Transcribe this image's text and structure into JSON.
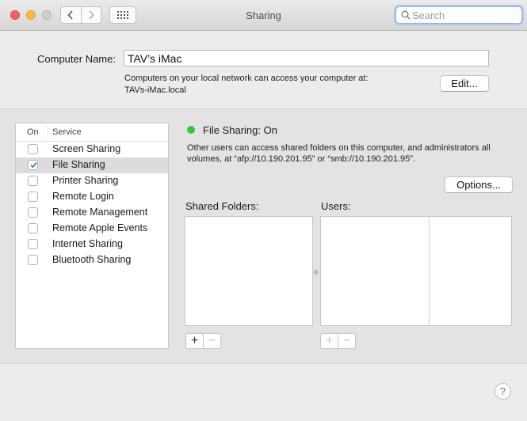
{
  "window": {
    "title": "Sharing"
  },
  "search": {
    "placeholder": "Search"
  },
  "computer_name": {
    "label": "Computer Name:",
    "value": "TAV’s iMac",
    "description_line1": "Computers on your local network can access your computer at:",
    "description_line2": "TAVs-iMac.local",
    "edit_label": "Edit..."
  },
  "services": {
    "header_on": "On",
    "header_service": "Service",
    "items": [
      {
        "label": "Screen Sharing",
        "checked": false
      },
      {
        "label": "File Sharing",
        "checked": true
      },
      {
        "label": "Printer Sharing",
        "checked": false
      },
      {
        "label": "Remote Login",
        "checked": false
      },
      {
        "label": "Remote Management",
        "checked": false
      },
      {
        "label": "Remote Apple Events",
        "checked": false
      },
      {
        "label": "Internet Sharing",
        "checked": false
      },
      {
        "label": "Bluetooth Sharing",
        "checked": false
      }
    ]
  },
  "status": {
    "text": "File Sharing: On",
    "color": "#35c63d",
    "description": "Other users can access shared folders on this computer, and administrators all volumes, at “afp://10.190.201.95” or “smb://10.190.201.95”."
  },
  "options_label": "Options...",
  "shared_folders_label": "Shared Folders:",
  "users_label": "Users:",
  "add_symbol": "+",
  "remove_symbol": "−",
  "help_symbol": "?",
  "icons": {
    "back": "chevron-left-icon",
    "forward": "chevron-right-icon",
    "grid": "grid-icon",
    "search": "search-icon",
    "check": "checkmark-icon"
  }
}
